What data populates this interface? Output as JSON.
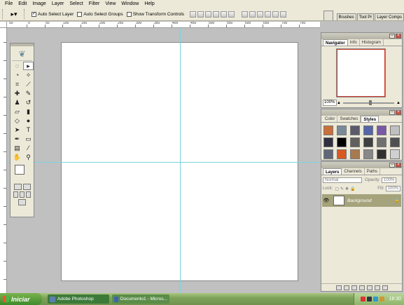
{
  "menu": [
    "File",
    "Edit",
    "Image",
    "Layer",
    "Select",
    "Filter",
    "View",
    "Window",
    "Help"
  ],
  "options_bar": {
    "auto_select_layer": {
      "label": "Auto Select Layer",
      "checked": true
    },
    "auto_select_groups": {
      "label": "Auto Select Groups",
      "checked": false
    },
    "show_transform_controls": {
      "label": "Show Transform Controls",
      "checked": false
    },
    "well_tabs": [
      "Brushes",
      "Tool Pr",
      "Layer Comps"
    ]
  },
  "ruler": {
    "h_labels": [
      "50",
      "0",
      "50",
      "100",
      "150",
      "200",
      "250",
      "300",
      "350",
      "400",
      "450",
      "500",
      "550",
      "600",
      "650",
      "700",
      "750"
    ]
  },
  "panels": {
    "navigator": {
      "tabs": [
        "Navigator",
        "Info",
        "Histogram"
      ],
      "zoom": "100%"
    },
    "styles": {
      "tabs": [
        "Color",
        "Swatches",
        "Styles"
      ]
    },
    "layers": {
      "tabs": [
        "Layers",
        "Channels",
        "Paths"
      ],
      "blend_mode": "Normal",
      "opacity_label": "Opacity:",
      "opacity": "100%",
      "lock_label": "Lock:",
      "fill_label": "Fill:",
      "fill": "100%",
      "layer_name": "Background"
    }
  },
  "taskbar": {
    "start_label": "Iniciar",
    "items": [
      {
        "label": "Adobe Photoshop"
      },
      {
        "label": "Documento1 - Micros..."
      }
    ],
    "clock": "18:30"
  },
  "colors": {
    "guide": "#7ad3e0",
    "selected_layer": "#a4a37c",
    "nav_box": "#d43b2e",
    "taskbar": "#7fa35a"
  }
}
